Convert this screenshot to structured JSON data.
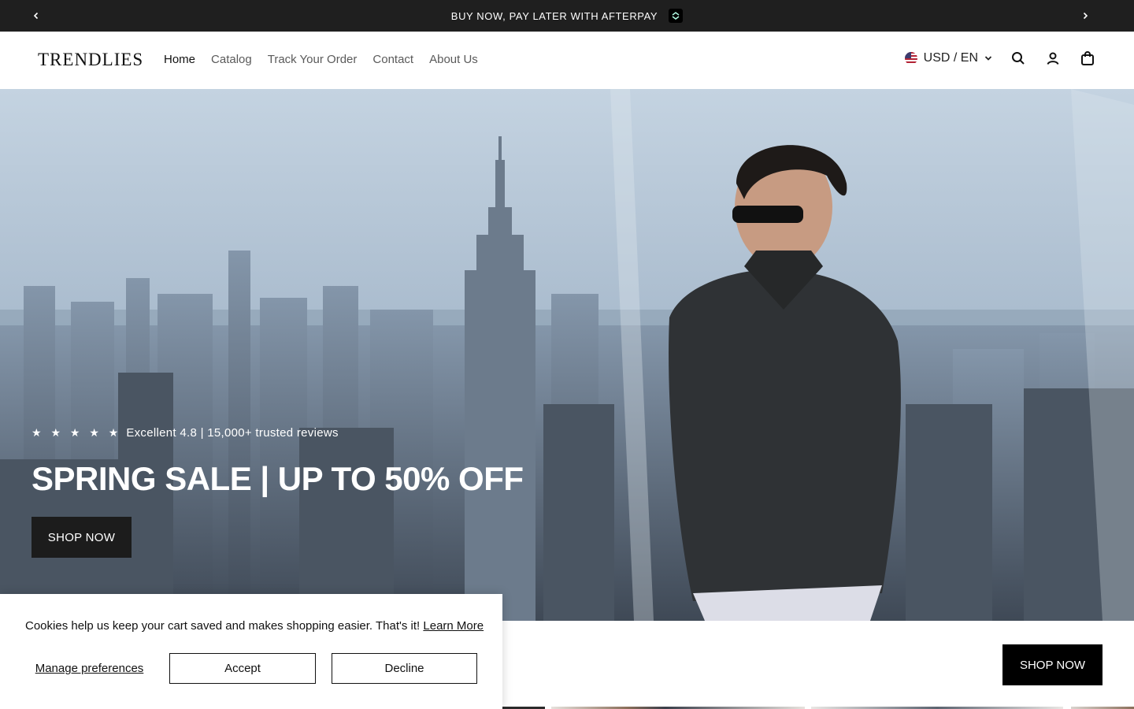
{
  "announcement": {
    "text": "BUY NOW, PAY LATER WITH AFTERPAY",
    "prev_icon": "chevron-left-icon",
    "next_icon": "chevron-right-icon",
    "badge_icon": "afterpay-icon"
  },
  "header": {
    "logo": "TRENDLIES",
    "nav": [
      {
        "label": "Home",
        "active": true
      },
      {
        "label": "Catalog"
      },
      {
        "label": "Track Your Order"
      },
      {
        "label": "Contact"
      },
      {
        "label": "About Us"
      }
    ],
    "locale": "USD / EN",
    "icons": [
      "us-flag-icon",
      "chevron-down-icon",
      "search-icon",
      "account-icon",
      "cart-icon"
    ]
  },
  "hero": {
    "stars": "★ ★ ★ ★ ★",
    "reviews": "Excellent 4.8 | 15,000+ trusted reviews",
    "headline": "SPRING SALE | UP TO 50% OFF",
    "cta": "SHOP NOW"
  },
  "promo": {
    "cta": "SHOP NOW"
  },
  "cookie_banner": {
    "message": "Cookies help us keep your cart saved and makes shopping easier. That's it!",
    "learn_more": "Learn More",
    "manage": "Manage preferences",
    "accept": "Accept",
    "decline": "Decline"
  },
  "colors": {
    "announcement_bg": "#1f1f1f",
    "button_dark": "#1c1c1c",
    "text": "#121212"
  }
}
